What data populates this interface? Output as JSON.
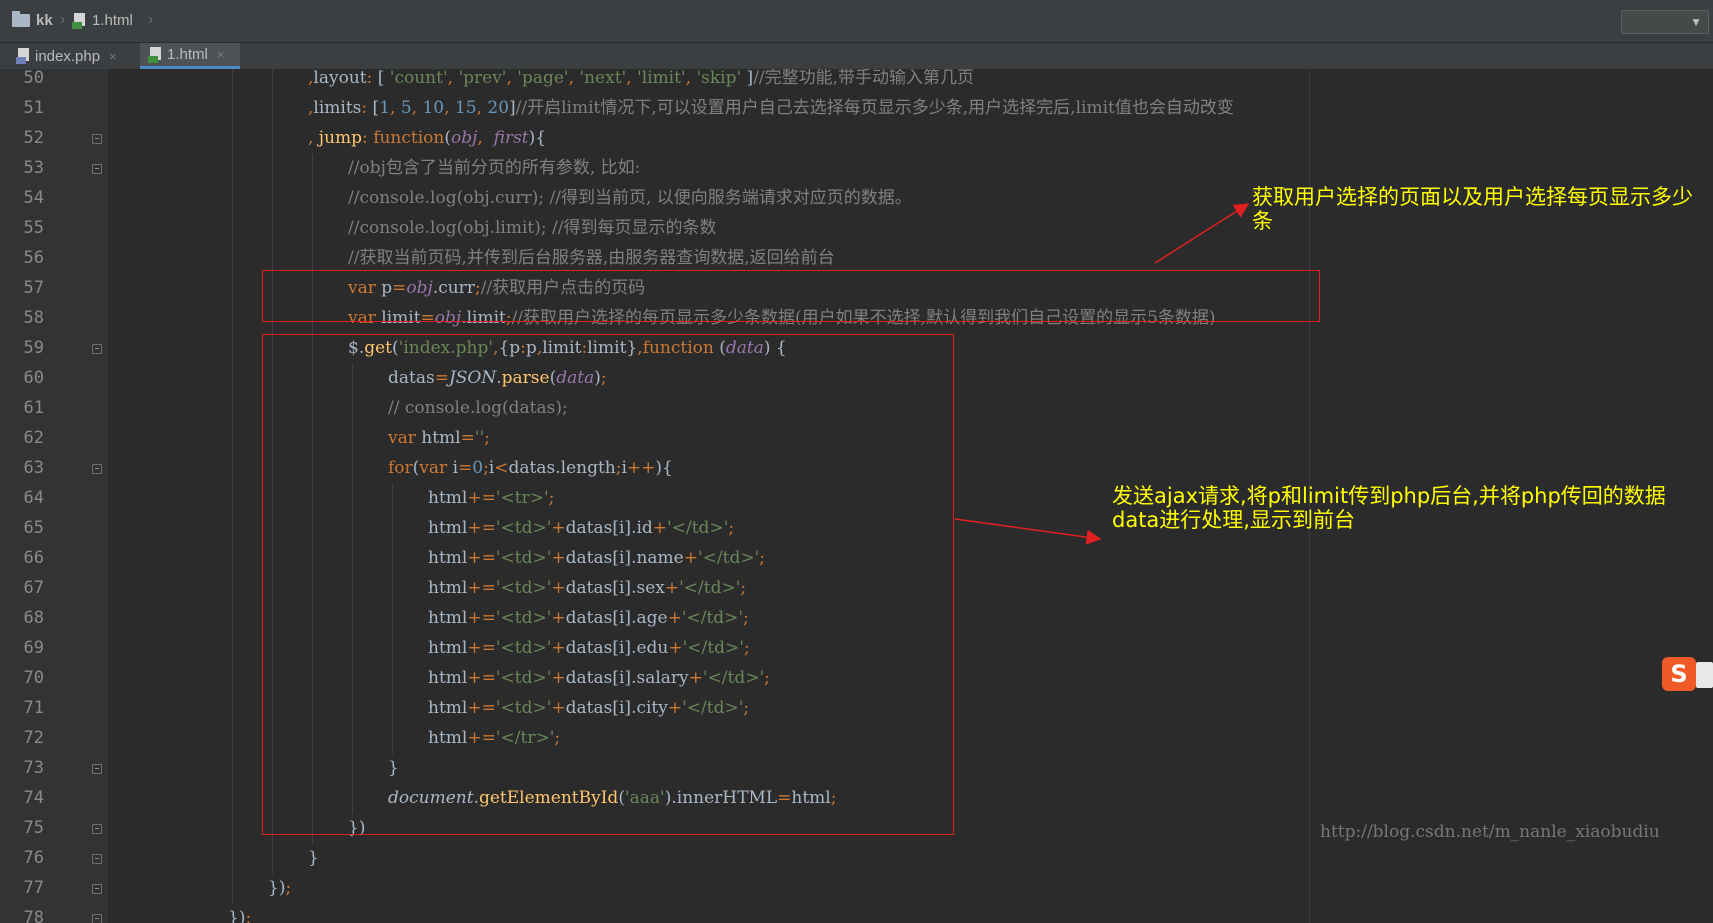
{
  "navbar": {
    "project": "kk",
    "file": "1.html"
  },
  "tabs": [
    {
      "label": "index.php",
      "close": "×"
    },
    {
      "label": "1.html",
      "close": "×"
    }
  ],
  "lines": [
    {
      "n": "50",
      "indent": 6,
      "tokens": [
        [
          "pc",
          ","
        ],
        [
          "",
          "layout"
        ],
        [
          "pc",
          ": "
        ],
        [
          "",
          "[ "
        ],
        [
          "str",
          "'count'"
        ],
        [
          "pc",
          ", "
        ],
        [
          "str",
          "'prev'"
        ],
        [
          "pc",
          ", "
        ],
        [
          "str",
          "'page'"
        ],
        [
          "pc",
          ", "
        ],
        [
          "str",
          "'next'"
        ],
        [
          "pc",
          ", "
        ],
        [
          "str",
          "'limit'"
        ],
        [
          "pc",
          ", "
        ],
        [
          "str",
          "'skip'"
        ],
        [
          "",
          " ]"
        ],
        [
          "cm",
          "//完整功能,带手动输入第几页"
        ]
      ]
    },
    {
      "n": "51",
      "indent": 6,
      "tokens": [
        [
          "pc",
          ","
        ],
        [
          "",
          "limits"
        ],
        [
          "pc",
          ": "
        ],
        [
          "",
          "["
        ],
        [
          "num",
          "1"
        ],
        [
          "pc",
          ", "
        ],
        [
          "num",
          "5"
        ],
        [
          "pc",
          ", "
        ],
        [
          "num",
          "10"
        ],
        [
          "pc",
          ", "
        ],
        [
          "num",
          "15"
        ],
        [
          "pc",
          ", "
        ],
        [
          "num",
          "20"
        ],
        [
          "",
          "]"
        ],
        [
          "cm",
          "//开启limit情况下,可以设置用户自己去选择每页显示多少条,用户选择完后,limit值也会自动改变"
        ]
      ]
    },
    {
      "n": "52",
      "indent": 6,
      "tokens": [
        [
          "pc",
          ","
        ],
        [
          "fn",
          " jump"
        ],
        [
          "pc",
          ": "
        ],
        [
          "kw",
          "function"
        ],
        [
          "",
          "("
        ],
        [
          "it",
          "obj"
        ],
        [
          "pc",
          ", "
        ],
        [
          "it",
          " first"
        ],
        [
          "",
          "){"
        ]
      ]
    },
    {
      "n": "53",
      "indent": 7,
      "tokens": [
        [
          "cm",
          "//obj包含了当前分页的所有参数, 比如:"
        ]
      ]
    },
    {
      "n": "54",
      "indent": 7,
      "tokens": [
        [
          "cm",
          "//console.log(obj.curr); //得到当前页, 以便向服务端请求对应页的数据。"
        ]
      ]
    },
    {
      "n": "55",
      "indent": 7,
      "tokens": [
        [
          "cm",
          "//console.log(obj.limit); //得到每页显示的条数"
        ]
      ]
    },
    {
      "n": "56",
      "indent": 7,
      "tokens": [
        [
          "cm",
          "//获取当前页码,并传到后台服务器,由服务器查询数据,返回给前台"
        ]
      ]
    },
    {
      "n": "57",
      "indent": 7,
      "tokens": [
        [
          "kw",
          "var "
        ],
        [
          "",
          "p"
        ],
        [
          "pc",
          "="
        ],
        [
          "it",
          "obj"
        ],
        [
          "",
          ".curr"
        ],
        [
          "pc",
          ";"
        ],
        [
          "cm",
          "//获取用户点击的页码"
        ]
      ]
    },
    {
      "n": "58",
      "indent": 7,
      "tokens": [
        [
          "kw",
          "var "
        ],
        [
          "",
          "limit"
        ],
        [
          "pc",
          "="
        ],
        [
          "it",
          "obj"
        ],
        [
          "",
          ".limit"
        ],
        [
          "pc",
          ";"
        ],
        [
          "cm",
          "//获取用户选择的每页显示多少条数据(用户如果不选择,默认得到我们自己设置的显示5条数据)"
        ]
      ]
    },
    {
      "n": "59",
      "indent": 7,
      "tokens": [
        [
          "",
          "$."
        ],
        [
          "fn",
          "get"
        ],
        [
          "",
          "("
        ],
        [
          "str",
          "'index.php'"
        ],
        [
          "pc",
          ","
        ],
        [
          "",
          "{p"
        ],
        [
          "pc",
          ":"
        ],
        [
          "",
          "p"
        ],
        [
          "pc",
          ","
        ],
        [
          "",
          "limit"
        ],
        [
          "pc",
          ":"
        ],
        [
          "",
          "limit}"
        ],
        [
          "pc",
          ","
        ],
        [
          "kw",
          "function "
        ],
        [
          "",
          "("
        ],
        [
          "it",
          "data"
        ],
        [
          "",
          ") {"
        ]
      ]
    },
    {
      "n": "60",
      "indent": 8,
      "tokens": [
        [
          "",
          "datas"
        ],
        [
          "pc",
          "="
        ],
        [
          "itw",
          "JSON"
        ],
        [
          "",
          "."
        ],
        [
          "fn",
          "parse"
        ],
        [
          "",
          "("
        ],
        [
          "it",
          "data"
        ],
        [
          "",
          ")"
        ],
        [
          "pc",
          ";"
        ]
      ]
    },
    {
      "n": "61",
      "indent": 8,
      "tokens": [
        [
          "cm",
          "// console.log(datas);"
        ]
      ]
    },
    {
      "n": "62",
      "indent": 8,
      "tokens": [
        [
          "kw",
          "var "
        ],
        [
          "",
          "html"
        ],
        [
          "pc",
          "="
        ],
        [
          "str",
          "''"
        ],
        [
          "pc",
          ";"
        ]
      ]
    },
    {
      "n": "63",
      "indent": 8,
      "tokens": [
        [
          "kw",
          "for"
        ],
        [
          "",
          "("
        ],
        [
          "kw",
          "var "
        ],
        [
          "",
          "i"
        ],
        [
          "pc",
          "="
        ],
        [
          "num",
          "0"
        ],
        [
          "pc",
          ";"
        ],
        [
          "",
          "i"
        ],
        [
          "pc",
          "<"
        ],
        [
          "",
          "datas.length"
        ],
        [
          "pc",
          ";"
        ],
        [
          "",
          "i"
        ],
        [
          "pc",
          "++"
        ],
        [
          "",
          "){"
        ]
      ]
    },
    {
      "n": "64",
      "indent": 9,
      "tokens": [
        [
          "",
          "html"
        ],
        [
          "pc",
          "+="
        ],
        [
          "str",
          "'<tr>'"
        ],
        [
          "pc",
          ";"
        ]
      ]
    },
    {
      "n": "65",
      "indent": 9,
      "tokens": [
        [
          "",
          "html"
        ],
        [
          "pc",
          "+="
        ],
        [
          "str",
          "'<td>'"
        ],
        [
          "pc",
          "+"
        ],
        [
          "",
          "datas[i].id"
        ],
        [
          "pc",
          "+"
        ],
        [
          "str",
          "'</td>'"
        ],
        [
          "pc",
          ";"
        ]
      ]
    },
    {
      "n": "66",
      "indent": 9,
      "tokens": [
        [
          "",
          "html"
        ],
        [
          "pc",
          "+="
        ],
        [
          "str",
          "'<td>'"
        ],
        [
          "pc",
          "+"
        ],
        [
          "",
          "datas[i].name"
        ],
        [
          "pc",
          "+"
        ],
        [
          "str",
          "'</td>'"
        ],
        [
          "pc",
          ";"
        ]
      ]
    },
    {
      "n": "67",
      "indent": 9,
      "tokens": [
        [
          "",
          "html"
        ],
        [
          "pc",
          "+="
        ],
        [
          "str",
          "'<td>'"
        ],
        [
          "pc",
          "+"
        ],
        [
          "",
          "datas[i].sex"
        ],
        [
          "pc",
          "+"
        ],
        [
          "str",
          "'</td>'"
        ],
        [
          "pc",
          ";"
        ]
      ]
    },
    {
      "n": "68",
      "indent": 9,
      "tokens": [
        [
          "",
          "html"
        ],
        [
          "pc",
          "+="
        ],
        [
          "str",
          "'<td>'"
        ],
        [
          "pc",
          "+"
        ],
        [
          "",
          "datas[i].age"
        ],
        [
          "pc",
          "+"
        ],
        [
          "str",
          "'</td>'"
        ],
        [
          "pc",
          ";"
        ]
      ]
    },
    {
      "n": "69",
      "indent": 9,
      "tokens": [
        [
          "",
          "html"
        ],
        [
          "pc",
          "+="
        ],
        [
          "str",
          "'<td>'"
        ],
        [
          "pc",
          "+"
        ],
        [
          "",
          "datas[i].edu"
        ],
        [
          "pc",
          "+"
        ],
        [
          "str",
          "'</td>'"
        ],
        [
          "pc",
          ";"
        ]
      ]
    },
    {
      "n": "70",
      "indent": 9,
      "tokens": [
        [
          "",
          "html"
        ],
        [
          "pc",
          "+="
        ],
        [
          "str",
          "'<td>'"
        ],
        [
          "pc",
          "+"
        ],
        [
          "",
          "datas[i].salary"
        ],
        [
          "pc",
          "+"
        ],
        [
          "str",
          "'</td>'"
        ],
        [
          "pc",
          ";"
        ]
      ]
    },
    {
      "n": "71",
      "indent": 9,
      "tokens": [
        [
          "",
          "html"
        ],
        [
          "pc",
          "+="
        ],
        [
          "str",
          "'<td>'"
        ],
        [
          "pc",
          "+"
        ],
        [
          "",
          "datas[i].city"
        ],
        [
          "pc",
          "+"
        ],
        [
          "str",
          "'</td>'"
        ],
        [
          "pc",
          ";"
        ]
      ]
    },
    {
      "n": "72",
      "indent": 9,
      "tokens": [
        [
          "",
          "html"
        ],
        [
          "pc",
          "+="
        ],
        [
          "str",
          "'</tr>'"
        ],
        [
          "pc",
          ";"
        ]
      ]
    },
    {
      "n": "73",
      "indent": 8,
      "tokens": [
        [
          "",
          "}"
        ]
      ]
    },
    {
      "n": "74",
      "indent": 8,
      "tokens": [
        [
          "itw",
          "document"
        ],
        [
          "",
          "."
        ],
        [
          "fn",
          "getElementById"
        ],
        [
          "",
          "("
        ],
        [
          "str",
          "'aaa'"
        ],
        [
          "",
          ").innerHTML"
        ],
        [
          "pc",
          "="
        ],
        [
          "",
          "html"
        ],
        [
          "pc",
          ";"
        ]
      ]
    },
    {
      "n": "75",
      "indent": 7,
      "tokens": [
        [
          "",
          "})"
        ]
      ]
    },
    {
      "n": "76",
      "indent": 6,
      "tokens": [
        [
          "",
          "}"
        ]
      ]
    },
    {
      "n": "77",
      "indent": 5,
      "tokens": [
        [
          "",
          "})"
        ],
        [
          "pc",
          ";"
        ]
      ]
    },
    {
      "n": "78",
      "indent": 4,
      "tokens": [
        [
          "",
          "})"
        ],
        [
          "pc",
          ";"
        ]
      ]
    }
  ],
  "annotations": {
    "top": "获取用户选择的页面以及用户选择每页显示多少条",
    "bottom": "发送ajax请求,将p和limit传到php后台,并将php传回的数据data进行处理,显示到前台"
  },
  "watermark": "http://blog.csdn.net/m_nanle_xiaobudiu",
  "ime_label": "S",
  "colors": {
    "annotation": "#ffff00",
    "box": "#e02020",
    "keyword": "#cc7832",
    "string": "#6a8759",
    "comment": "#808080"
  }
}
